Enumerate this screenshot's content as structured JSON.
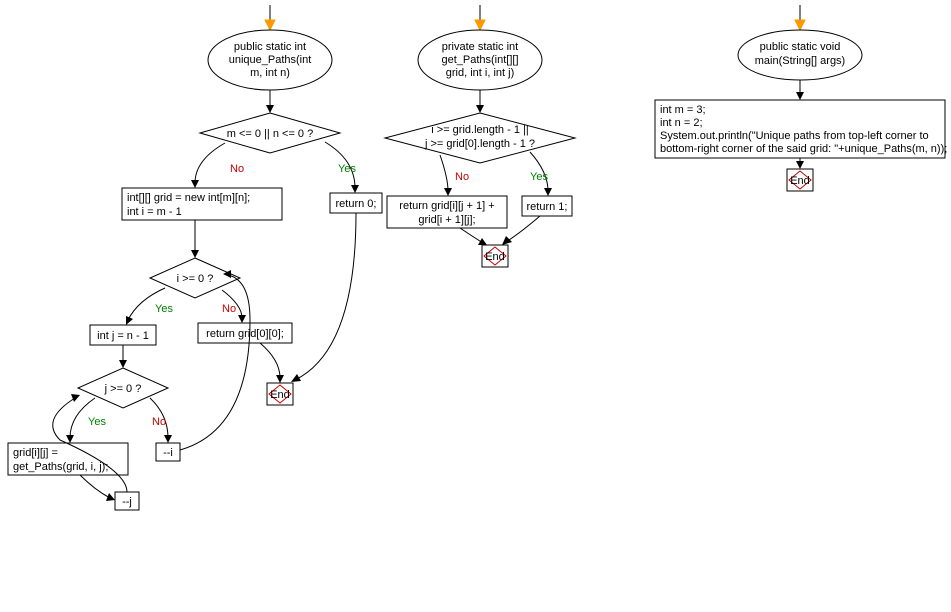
{
  "flowchart1": {
    "start": "public static int\nunique_Paths(int\nm, int n)",
    "cond1": "m <= 0 || n <= 0 ?",
    "ret0": "return 0;",
    "init": "int[][] grid = new int[m][n];\nint i = m - 1",
    "cond2": "i >= 0 ?",
    "retGrid": "return grid[0][0];",
    "initJ": "int j = n - 1",
    "cond3": "j >= 0 ?",
    "assign": "grid[i][j] =\nget_Paths(grid, i, j);",
    "decJ": "--j",
    "decI": "--i"
  },
  "flowchart2": {
    "start": "private static int\nget_Paths(int[][]\ngrid, int i, int j)",
    "cond": "i >= grid.length - 1 ||\nj >= grid[0].length - 1 ?",
    "ret1": "return 1;",
    "retSum": "return grid[i][j + 1] +\ngrid[i + 1][j];"
  },
  "flowchart3": {
    "start": "public static void\nmain(String[] args)",
    "body": "int m = 3;\nint n = 2;\nSystem.out.println(\"Unique paths from top-left corner to\nbottom-right corner of the said grid: \"+unique_Paths(m, n));"
  },
  "labels": {
    "yes": "Yes",
    "no": "No",
    "end": "End"
  }
}
